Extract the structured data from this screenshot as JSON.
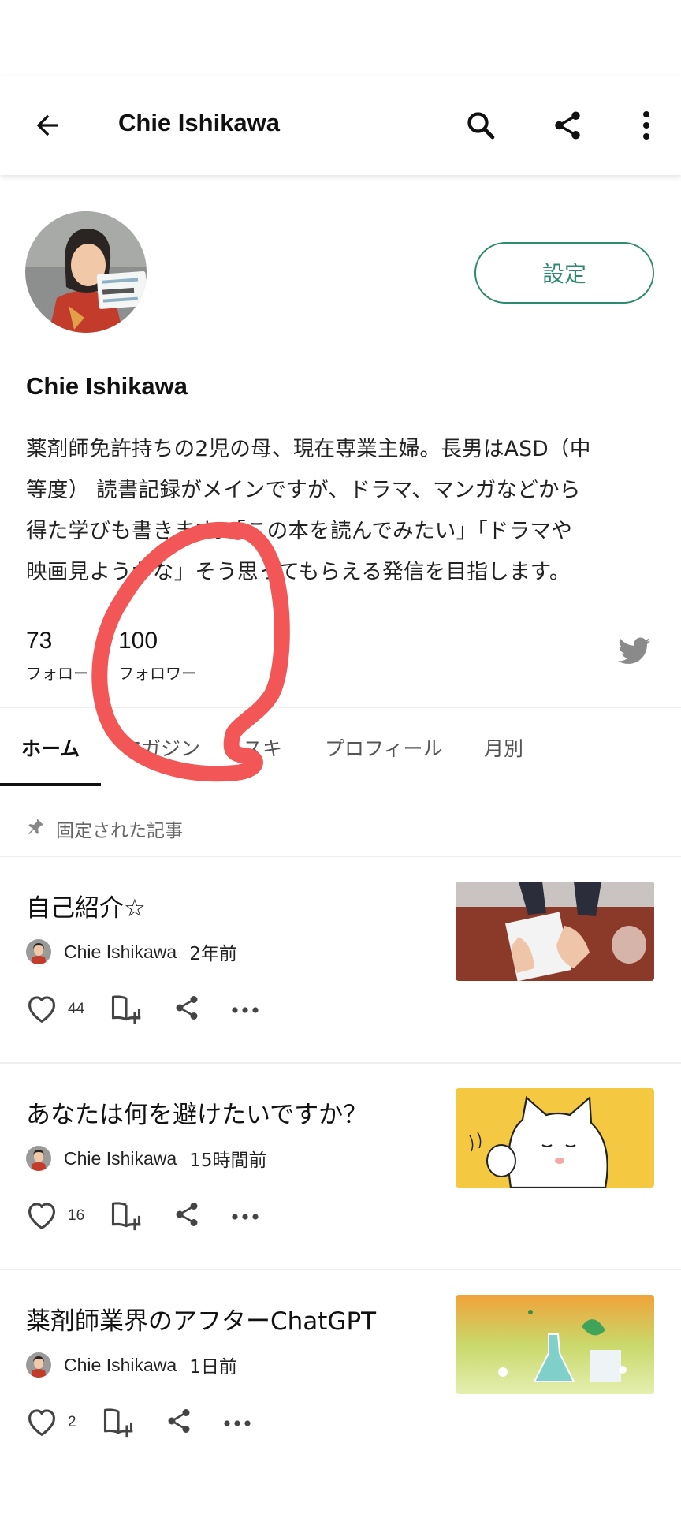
{
  "header": {
    "title": "Chie Ishikawa",
    "icons": [
      "back-arrow-icon",
      "search-icon",
      "share-icon",
      "more-vertical-icon"
    ]
  },
  "profile": {
    "name": "Chie Ishikawa",
    "settings_label": "設定",
    "bio_lines": [
      "薬剤師免許持ちの2児の母、現在専業主婦。長男はASD（中",
      "等度） 読書記録がメインですが、ドラマ、マンガなどから",
      "得た学びも書きます。「この本を読んでみたい」「ドラマや",
      "映画見ようかな」そう思ってもらえる発信を目指します。"
    ],
    "following_count": "73",
    "following_label": "フォロー",
    "followers_count": "100",
    "followers_label": "フォロワー"
  },
  "tabs": [
    "ホーム",
    "マガジン",
    "スキ",
    "プロフィール",
    "月別"
  ],
  "active_tab": "ホーム",
  "pinned_label": "固定された記事",
  "articles": [
    {
      "title": "自己紹介☆",
      "author": "Chie Ishikawa",
      "time": "2年前",
      "likes": "44"
    },
    {
      "title": "あなたは何を避けたいですか？",
      "author": "Chie Ishikawa",
      "time": "15時間前",
      "likes": "16"
    },
    {
      "title": "薬剤師業界のアフターChatGPT",
      "author": "Chie Ishikawa",
      "time": "1日前",
      "likes": "2"
    }
  ],
  "colors": {
    "accent": "#2e8a6e",
    "twitter": "#8a8a8a",
    "annotation": "#f25656"
  }
}
